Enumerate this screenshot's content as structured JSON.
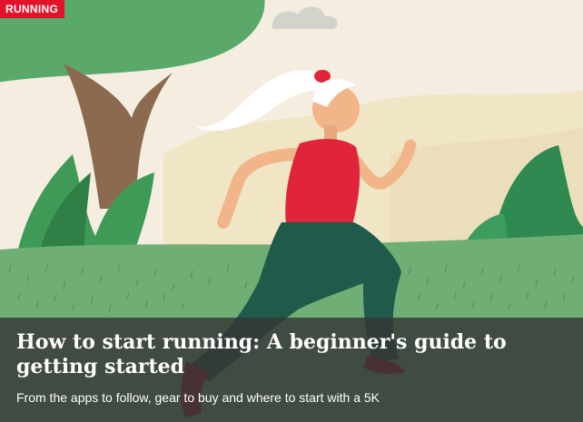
{
  "article": {
    "category": "RUNNING",
    "title": "How to start running: A beginner's guide to getting started",
    "subtitle": "From the apps to follow, gear to buy and where to start with a 5K"
  },
  "colors": {
    "badge": "#e3122b",
    "sky": "#f3ecd8",
    "grass": "#6fae74",
    "foliage": "#5cad6a",
    "shirt": "#e0253b",
    "leggings": "#1f5a4b"
  }
}
